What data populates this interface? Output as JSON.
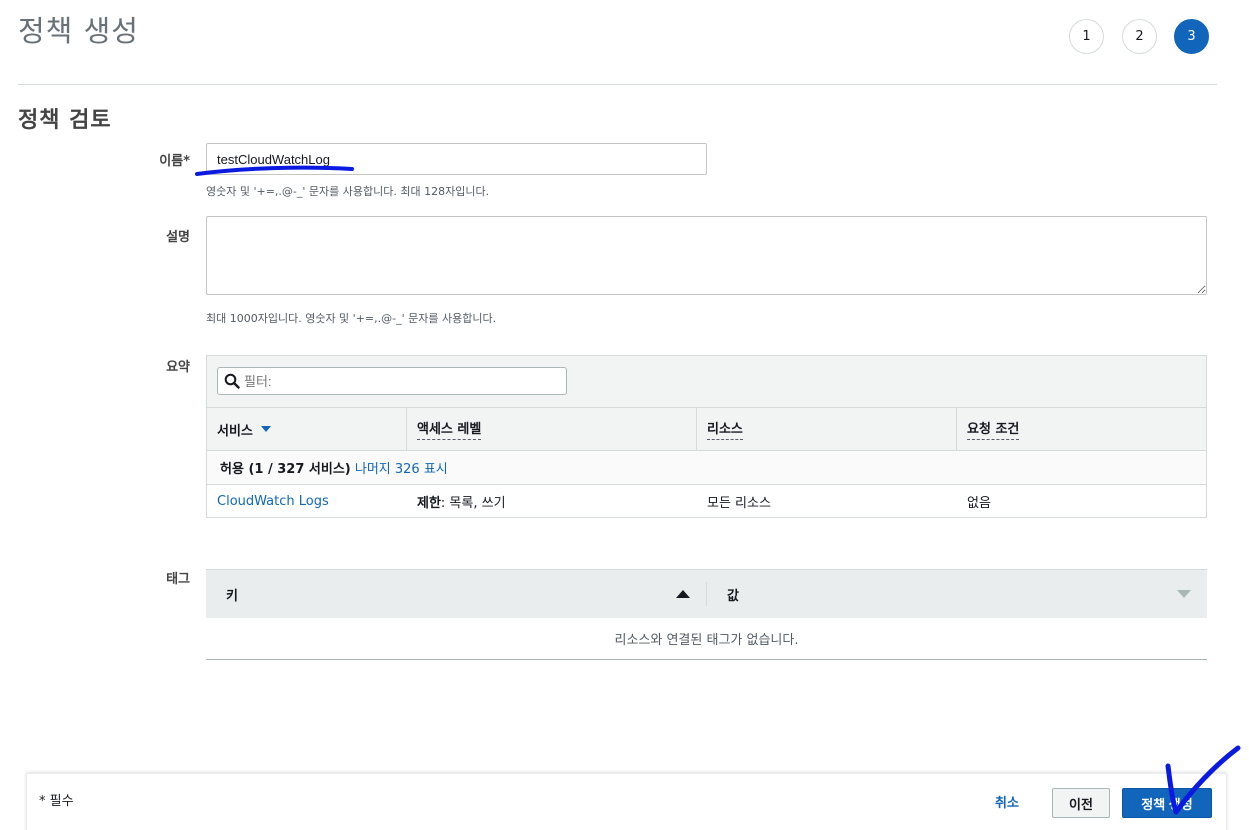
{
  "page": {
    "title": "정책 생성",
    "section_title": "정책 검토"
  },
  "steps": [
    "1",
    "2",
    "3"
  ],
  "form": {
    "name_label": "이름*",
    "name_value": "testCloudWatchLog",
    "name_hint": "영숫자 및 '+=,.@-_' 문자를 사용합니다. 최대 128자입니다.",
    "desc_label": "설명",
    "desc_value": "",
    "desc_hint": "최대 1000자입니다. 영숫자 및 '+=,.@-_' 문자를 사용합니다.",
    "summary_label": "요약",
    "tag_label": "태그"
  },
  "summary": {
    "filter_placeholder": "필터:",
    "headers": [
      "서비스",
      "액세스 레벨",
      "리소스",
      "요청 조건"
    ],
    "allow_prefix": "허용 (1 / 327 서비스)",
    "allow_link": "나머지 326 표시",
    "rows": [
      {
        "service": "CloudWatch Logs",
        "access_bold": "제한",
        "access_rest": ": 목록, 쓰기",
        "resource": "모든 리소스",
        "condition": "없음"
      }
    ]
  },
  "tags": {
    "headers": [
      "키",
      "값"
    ],
    "empty_message": "리소스와 연결된 태그가 없습니다."
  },
  "footer": {
    "required_note": "* 필수",
    "cancel_label": "취소",
    "previous_label": "이전",
    "create_label": "정책 생성"
  },
  "colors": {
    "primary": "#1166bb",
    "annotation": "#0a1ae0"
  },
  "icons": [
    "search-icon",
    "sort-down-icon",
    "sort-up-icon"
  ]
}
